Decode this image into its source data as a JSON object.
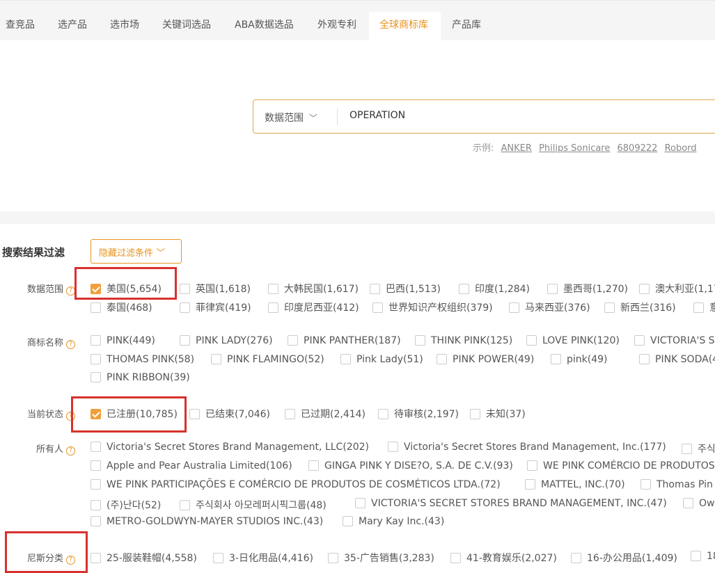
{
  "nav": {
    "tabs": [
      "查竞品",
      "选产品",
      "选市场",
      "关键词选品",
      "ABA数据选品",
      "外观专利",
      "全球商标库",
      "产品库"
    ],
    "active_tab": "全球商标库",
    "accent_color": "#e8931d"
  },
  "search": {
    "scope_label": "数据范围",
    "query": "OPERATION",
    "examples_label": "示例:",
    "examples": [
      "ANKER",
      "Philips Sonicare",
      "6809222",
      "Robord"
    ]
  },
  "filters": {
    "title": "搜索结果过滤",
    "hide_button": "隐藏过滤条件",
    "rows": {
      "scope": {
        "label": "数据范围",
        "options": [
          "美国(5,654)",
          "英国(1,618)",
          "大韩民国(1,617)",
          "巴西(1,513)",
          "印度(1,284)",
          "墨西哥(1,270)",
          "澳大利亚(1,17",
          "泰国(468)",
          "菲律宾(419)",
          "印度尼西亚(412)",
          "世界知识产权组织(379)",
          "马来西亚(376)",
          "新西兰(316)",
          "意"
        ]
      },
      "name": {
        "label": "商标名称",
        "options": [
          "PINK(449)",
          "PINK LADY(276)",
          "PINK PANTHER(187)",
          "THINK PINK(125)",
          "LOVE PINK(120)",
          "VICTORIA'S S",
          "THOMAS PINK(58)",
          "PINK FLAMINGO(52)",
          "Pink Lady(51)",
          "PINK POWER(49)",
          "pink(49)",
          "PINK SODA(4",
          "PINK RIBBON(39)"
        ]
      },
      "status": {
        "label": "当前状态",
        "options": [
          "已注册(10,785)",
          "已结束(7,046)",
          "已过期(2,414)",
          "待审核(2,197)",
          "未知(37)"
        ]
      },
      "owner": {
        "label": "所有人",
        "options": [
          "Victoria's Secret Stores Brand Management, LLC(202)",
          "Victoria's Secret Stores Brand Management, Inc.(177)",
          "주식",
          "Apple and Pear Australia Limited(106)",
          "GINGA PINK Y DISE?O, S.A. DE C.V.(93)",
          "WE PINK COMÉRCIO DE PRODUTOS",
          "WE PINK PARTICIPAÇÕES E COMÉRCIO DE PRODUTOS DE COSMÉTICOS LTDA.(72)",
          "MATTEL, INC.(70)",
          "Thomas Pin",
          "(주)난다(52)",
          "주식회사 아모레퍼시픽그룹(48)",
          "VICTORIA'S SECRET STORES BRAND MANAGEMENT, INC.(47)",
          "Ow",
          "METRO-GOLDWYN-MAYER STUDIOS INC.(43)",
          "Mary Kay Inc.(43)"
        ]
      },
      "nice": {
        "label": "尼斯分类",
        "options": [
          "25-服装鞋帽(4,558)",
          "3-日化用品(4,416)",
          "35-广告销售(3,283)",
          "41-教育娱乐(2,027)",
          "16-办公用品(1,409)",
          "18"
        ]
      }
    }
  }
}
